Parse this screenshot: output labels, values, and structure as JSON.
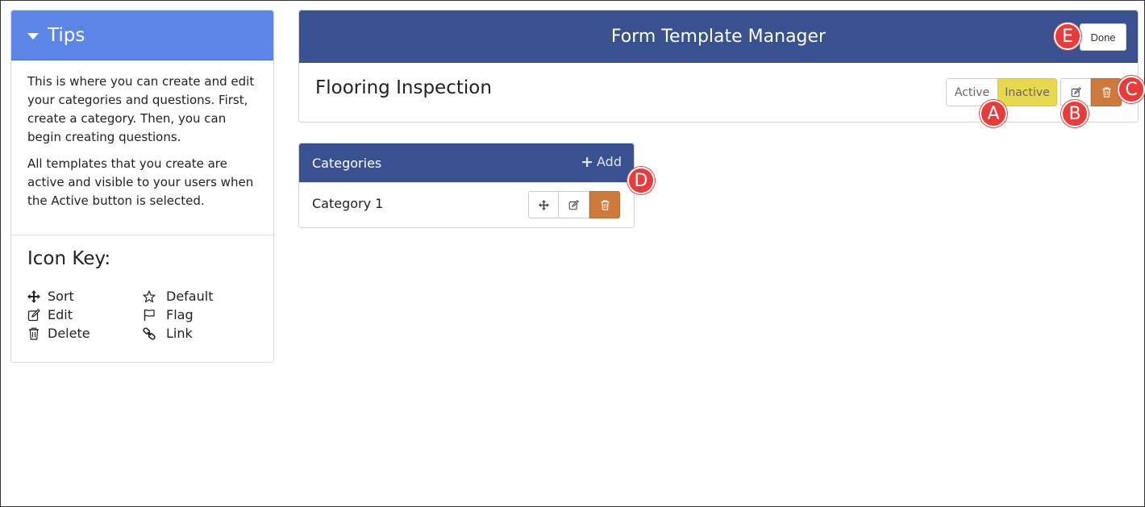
{
  "tips": {
    "title": "Tips",
    "paragraph1": "This is where you can create and edit your categories and questions. First, create a category. Then, you can begin creating questions.",
    "paragraph2": "All templates that you create are active and visible to your users when the Active button is selected.",
    "icon_key_title": "Icon Key:",
    "icon_key": [
      {
        "label": "Sort",
        "icon": "move-arrows-icon"
      },
      {
        "label": "Default",
        "icon": "star-outline-icon"
      },
      {
        "label": "Edit",
        "icon": "edit-icon"
      },
      {
        "label": "Flag",
        "icon": "flag-icon"
      },
      {
        "label": "Delete",
        "icon": "trash-icon"
      },
      {
        "label": "Link",
        "icon": "link-icon"
      }
    ]
  },
  "header": {
    "title": "Form Template Manager",
    "done_label": "Done"
  },
  "template": {
    "name": "Flooring Inspection",
    "active_label": "Active",
    "inactive_label": "Inactive",
    "selected_state": "Inactive"
  },
  "categories": {
    "title": "Categories",
    "add_label": "Add",
    "items": [
      {
        "label": "Category 1"
      }
    ]
  },
  "markers": [
    "A",
    "B",
    "C",
    "D",
    "E"
  ],
  "colors": {
    "header_blue": "#3a5191",
    "tips_blue": "#5b86e8",
    "inactive_yellow": "#e8d84e",
    "delete_orange": "#cf7a3c",
    "marker_red": "#e83c3c"
  }
}
